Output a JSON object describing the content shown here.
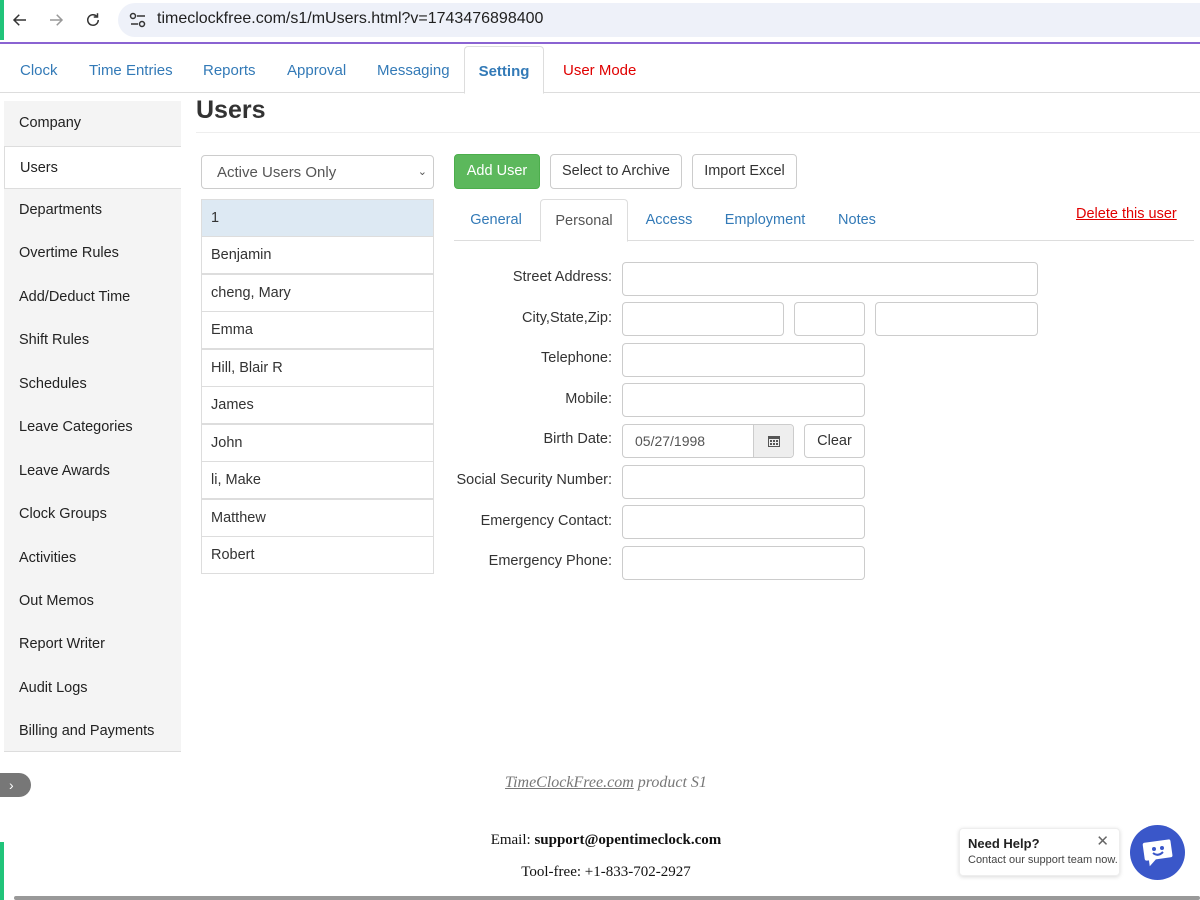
{
  "browser": {
    "url": "timeclockfree.com/s1/mUsers.html?v=1743476898400"
  },
  "top_tabs": [
    {
      "label": "Clock"
    },
    {
      "label": "Time Entries"
    },
    {
      "label": "Reports"
    },
    {
      "label": "Approval"
    },
    {
      "label": "Messaging"
    },
    {
      "label": "Setting"
    },
    {
      "label": "User Mode"
    }
  ],
  "sidebar": {
    "items": [
      {
        "label": "Company"
      },
      {
        "label": "Users"
      },
      {
        "label": "Departments"
      },
      {
        "label": "Overtime Rules"
      },
      {
        "label": "Add/Deduct Time"
      },
      {
        "label": "Shift Rules"
      },
      {
        "label": "Schedules"
      },
      {
        "label": "Leave Categories"
      },
      {
        "label": "Leave Awards"
      },
      {
        "label": "Clock Groups"
      },
      {
        "label": "Activities"
      },
      {
        "label": "Out Memos"
      },
      {
        "label": "Report Writer"
      },
      {
        "label": "Audit Logs"
      },
      {
        "label": "Billing and Payments"
      }
    ],
    "collapse_glyph": "›"
  },
  "page": {
    "title": "Users"
  },
  "filter": {
    "selected": "Active Users Only",
    "chevron": "⌄"
  },
  "users": [
    "1",
    "Benjamin",
    "cheng, Mary",
    "Emma",
    "Hill, Blair R",
    "James",
    "John",
    "li, Make",
    "Matthew",
    "Robert"
  ],
  "toolbar": {
    "add_user": "Add User",
    "select_archive": "Select to Archive",
    "import_excel": "Import Excel"
  },
  "sub_tabs": [
    {
      "label": "General"
    },
    {
      "label": "Personal"
    },
    {
      "label": "Access"
    },
    {
      "label": "Employment"
    },
    {
      "label": "Notes"
    }
  ],
  "delete_link": "Delete this user",
  "form": {
    "street_label": "Street Address:",
    "city_label": "City,State,Zip:",
    "telephone_label": "Telephone:",
    "mobile_label": "Mobile:",
    "birth_label": "Birth Date:",
    "birth_value": "05/27/1998",
    "clear_label": "Clear",
    "ssn_label": "Social Security Number:",
    "emergency_contact_label": "Emergency Contact:",
    "emergency_phone_label": "Emergency Phone:"
  },
  "footer": {
    "product_link": "TimeClockFree.com",
    "product_suffix": " product S1",
    "email_prefix": "Email: ",
    "email": "support@opentimeclock.com",
    "phone": "Tool-free: +1-833-702-2927"
  },
  "help": {
    "title": "Need Help?",
    "subtitle": "Contact our support team now.",
    "close": "✕"
  },
  "colors": {
    "link_blue": "#337ab7",
    "danger_red": "#e00000",
    "add_green": "#5cb85c",
    "active_row": "#dde9f3",
    "chat_blue": "#3a57c9"
  }
}
